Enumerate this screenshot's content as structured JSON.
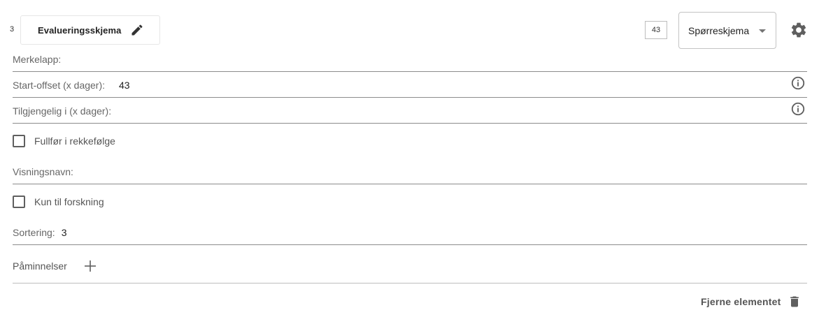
{
  "item": {
    "number": "3",
    "title": "Evalueringsskjema",
    "count": "43",
    "type_selected": "Spørreskjema"
  },
  "fields": {
    "label": {
      "label": "Merkelapp:",
      "value": ""
    },
    "start_offset": {
      "label": "Start-offset (x dager):",
      "value": "43"
    },
    "available": {
      "label": "Tilgjengelig i (x dager):",
      "value": ""
    },
    "display_name": {
      "label": "Visningsnavn:",
      "value": ""
    },
    "sorting": {
      "label": "Sortering:",
      "value": "3"
    }
  },
  "checkboxes": {
    "complete_in_order": {
      "label": "Fullfør i rekkefølge",
      "checked": false
    },
    "research_only": {
      "label": "Kun til forskning",
      "checked": false
    }
  },
  "reminders": {
    "label": "Påminnelser"
  },
  "actions": {
    "remove_label": "Fjerne elementet"
  },
  "icons": {
    "edit": "pencil-icon",
    "settings": "gear-icon",
    "info": "info-icon",
    "add": "plus-icon",
    "remove": "trash-icon"
  },
  "colors": {
    "icon": "#5f5f5f",
    "text": "#212121",
    "label": "#666666"
  }
}
